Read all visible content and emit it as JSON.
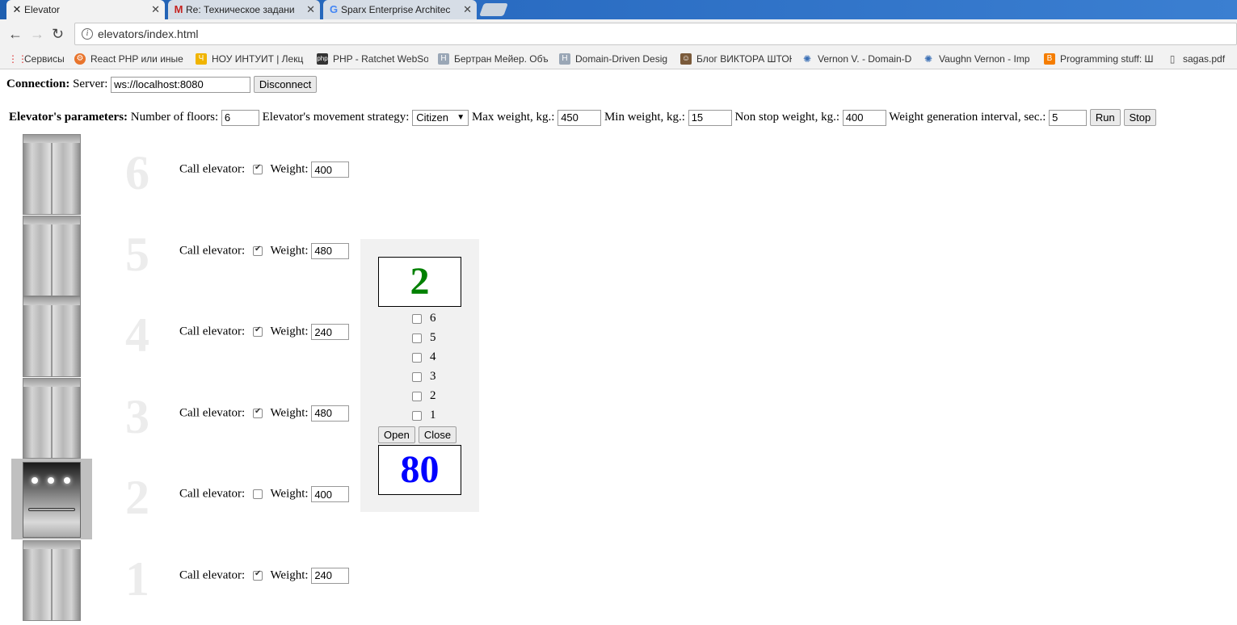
{
  "browser": {
    "tabs": [
      {
        "title": "Elevator",
        "icon": "elevator-icon",
        "active": true
      },
      {
        "title": "Re: Техническое задани",
        "icon": "gmail-icon",
        "active": false
      },
      {
        "title": "Sparx Enterprise Architec",
        "icon": "google-icon",
        "active": false
      }
    ],
    "tab_close": "✕",
    "url": "elevators/index.html",
    "bookmarks": [
      {
        "label": "Сервисы",
        "icon": "apps-grid-icon"
      },
      {
        "label": "React PHP или иные",
        "icon": "reactphp-icon"
      },
      {
        "label": "НОУ ИНТУИТ | Лекц",
        "icon": "intuit-icon"
      },
      {
        "label": "PHP - Ratchet WebSo",
        "icon": "php-icon"
      },
      {
        "label": "Бертран Мейер. Объ",
        "icon": "h-page-icon"
      },
      {
        "label": "Domain-Driven Desig",
        "icon": "h-page-icon"
      },
      {
        "label": "Блог ВИКТОРА ШТОН",
        "icon": "avatar-icon"
      },
      {
        "label": "Vernon V. - Domain-D",
        "icon": "torrent-icon"
      },
      {
        "label": "Vaughn Vernon - Imp",
        "icon": "torrent-icon"
      },
      {
        "label": "Programming stuff: Ш",
        "icon": "blogger-icon"
      },
      {
        "label": "sagas.pdf",
        "icon": "document-icon"
      }
    ]
  },
  "connection": {
    "label": "Connection:",
    "server_label": "Server:",
    "server_value": "ws://localhost:8080",
    "disconnect_label": "Disconnect"
  },
  "params": {
    "label": "Elevator's parameters:",
    "floors_label": "Number of floors:",
    "floors_value": "6",
    "strategy_label": "Elevator's movement strategy:",
    "strategy_value": "Citizen",
    "max_weight_label": "Max weight, kg.:",
    "max_weight_value": "450",
    "min_weight_label": "Min weight, kg.:",
    "min_weight_value": "15",
    "nonstop_label": "Non stop weight, kg.:",
    "nonstop_value": "400",
    "interval_label": "Weight generation interval, sec.:",
    "interval_value": "5",
    "run_label": "Run",
    "stop_label": "Stop"
  },
  "floors": [
    {
      "number": "6",
      "call_label": "Call elevator:",
      "called": true,
      "weight_label": "Weight:",
      "weight": "400",
      "cabin_here": false
    },
    {
      "number": "5",
      "call_label": "Call elevator:",
      "called": true,
      "weight_label": "Weight:",
      "weight": "480",
      "cabin_here": false
    },
    {
      "number": "4",
      "call_label": "Call elevator:",
      "called": true,
      "weight_label": "Weight:",
      "weight": "240",
      "cabin_here": false
    },
    {
      "number": "3",
      "call_label": "Call elevator:",
      "called": true,
      "weight_label": "Weight:",
      "weight": "480",
      "cabin_here": false
    },
    {
      "number": "2",
      "call_label": "Call elevator:",
      "called": false,
      "weight_label": "Weight:",
      "weight": "400",
      "cabin_here": true
    },
    {
      "number": "1",
      "call_label": "Call elevator:",
      "called": true,
      "weight_label": "Weight:",
      "weight": "240",
      "cabin_here": false
    }
  ],
  "panel": {
    "current_floor": "2",
    "current_floor_color": "#008000",
    "floor_buttons": [
      "6",
      "5",
      "4",
      "3",
      "2",
      "1"
    ],
    "open_label": "Open",
    "close_label": "Close",
    "weight": "80",
    "weight_color": "#0000ff"
  }
}
